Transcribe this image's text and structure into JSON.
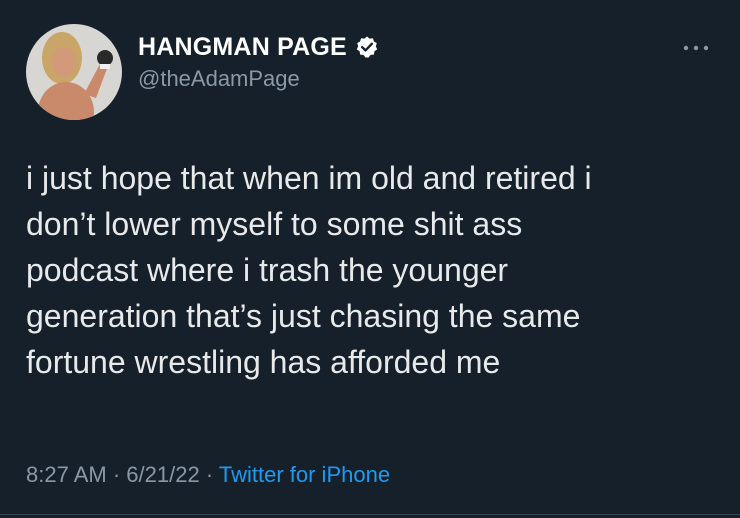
{
  "tweet": {
    "author": {
      "display_name": "HANGMAN PAGE",
      "handle": "@theAdamPage",
      "verified": true
    },
    "text_lines": [
      "i just hope that when im old and retired i",
      "don’t lower myself to some shit ass",
      "podcast where i trash the younger",
      "generation that’s just chasing the same",
      "fortune wrestling has afforded me"
    ],
    "time": "8:27 AM",
    "separator": "·",
    "date": "6/21/22",
    "source": "Twitter for iPhone"
  },
  "colors": {
    "background": "#15202b",
    "text": "#e7e9ea",
    "secondary_text": "#8b98a5",
    "link": "#1d9bf0"
  },
  "icons": {
    "verified": "verified-badge-icon",
    "more": "more-options-icon"
  }
}
